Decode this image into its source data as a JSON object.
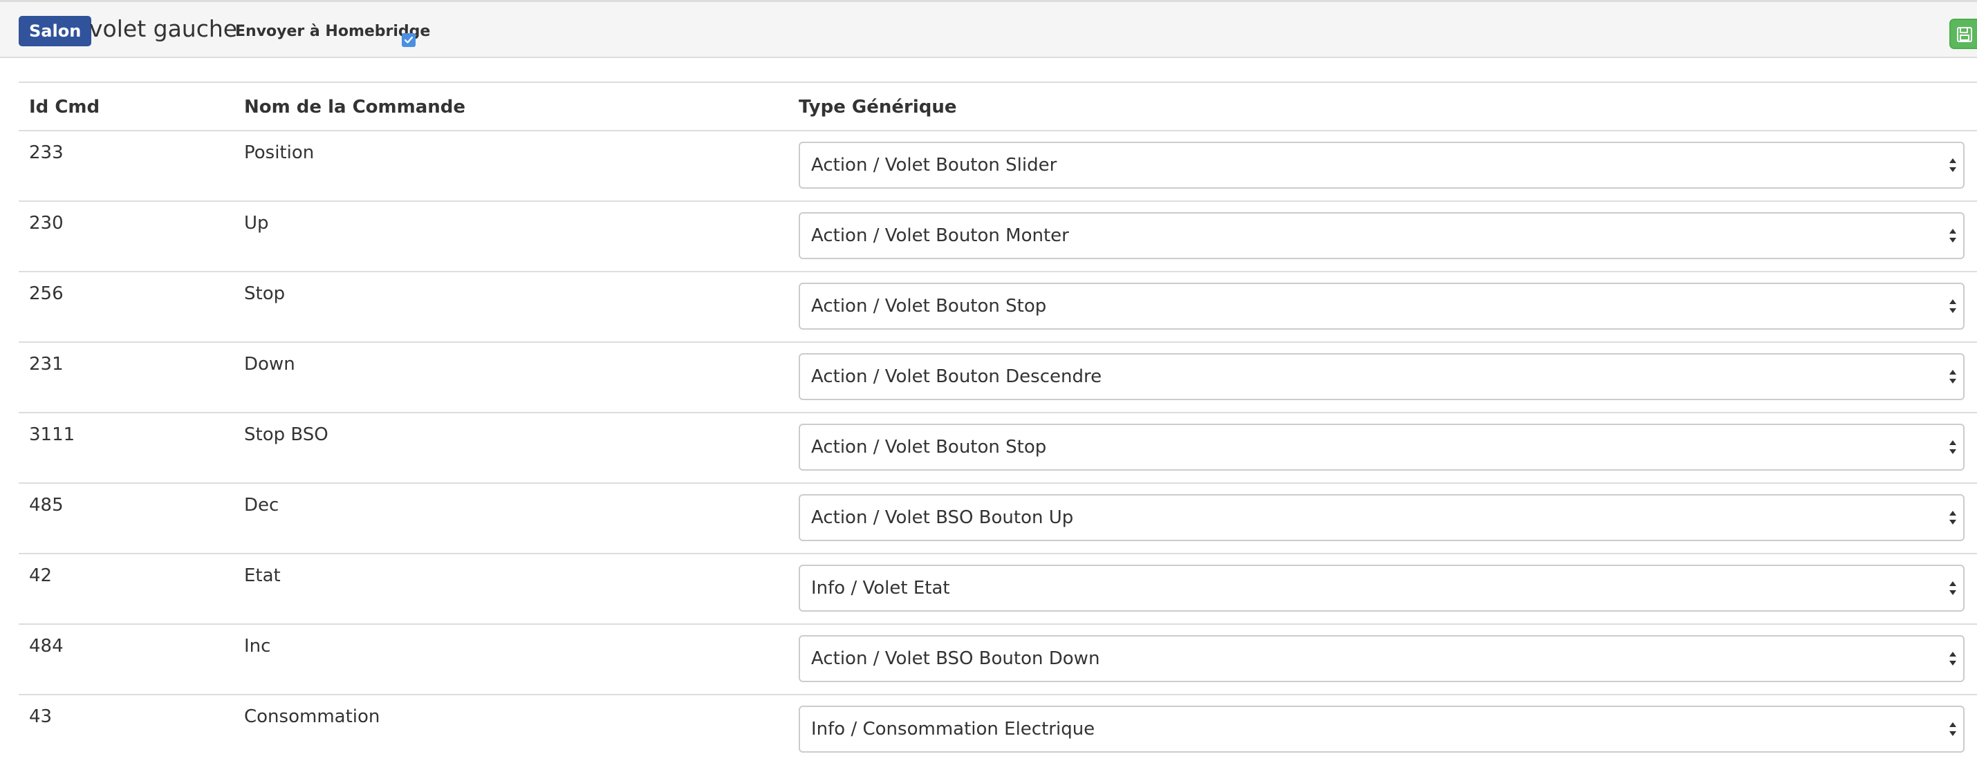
{
  "header": {
    "room_badge": "Salon",
    "equipment_name": "volet gauche",
    "homebridge_label": "Envoyer à Homebridge",
    "homebridge_checked": true,
    "save_icon": "floppy-disk-icon"
  },
  "table": {
    "columns": [
      "Id Cmd",
      "Nom de la Commande",
      "Type Générique"
    ],
    "rows": [
      {
        "id": "233",
        "name": "Position",
        "type": "Action / Volet Bouton Slider"
      },
      {
        "id": "230",
        "name": "Up",
        "type": "Action / Volet Bouton Monter"
      },
      {
        "id": "256",
        "name": "Stop",
        "type": "Action / Volet Bouton Stop"
      },
      {
        "id": "231",
        "name": "Down",
        "type": "Action / Volet Bouton Descendre"
      },
      {
        "id": "3111",
        "name": "Stop BSO",
        "type": "Action / Volet Bouton Stop"
      },
      {
        "id": "485",
        "name": "Dec",
        "type": "Action / Volet BSO Bouton Up"
      },
      {
        "id": "42",
        "name": "Etat",
        "type": "Info / Volet Etat"
      },
      {
        "id": "484",
        "name": "Inc",
        "type": "Action / Volet BSO Bouton Down"
      },
      {
        "id": "43",
        "name": "Consommation",
        "type": "Info / Consommation Electrique"
      }
    ]
  },
  "colors": {
    "badge": "#30539b",
    "save_button": "#5cb85c",
    "checkbox": "#4a90e2"
  }
}
